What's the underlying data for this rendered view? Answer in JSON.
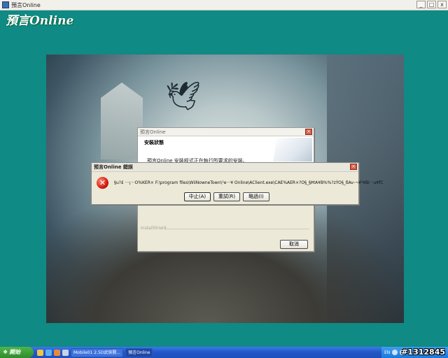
{
  "outer_window": {
    "title": "預言Online",
    "min_label": "_",
    "max_label": "□",
    "close_label": "x"
  },
  "game_logo": "預言Online",
  "setup_dialog": {
    "title": "預言Online",
    "header_title": "安裝狀態",
    "header_desc": "預言Online 安裝程式正在執行所要求的安裝。",
    "brand": "InstallShield",
    "cancel_label": "取消"
  },
  "error_dialog": {
    "title": "預言Online 錯誤",
    "message": "§u?£ ···¡···O%KER× F:\\program files\\WiiNowneTown\\¹e···¥ Online\\AClient.exe\\CAE%AER×?O§_§ÞtA¥B%%?zÝO§_ßAv-¬¥¹¥Bi···u¥fC",
    "icon_symbol": "✕",
    "abort_label": "中止(A)",
    "retry_label": "重試(R)",
    "ignore_label": "略過(I)"
  },
  "taskbar": {
    "start_label": "開始",
    "items": [
      "Mobile01 2.5D武俠開...",
      "預言Online"
    ],
    "lang": "EN"
  },
  "watermark": "#1312845",
  "colors": {
    "desktop_bg": "#0f8a84",
    "taskbar": "#2356c7",
    "start_button": "#2f8c2b",
    "error_icon": "#d21a10"
  }
}
